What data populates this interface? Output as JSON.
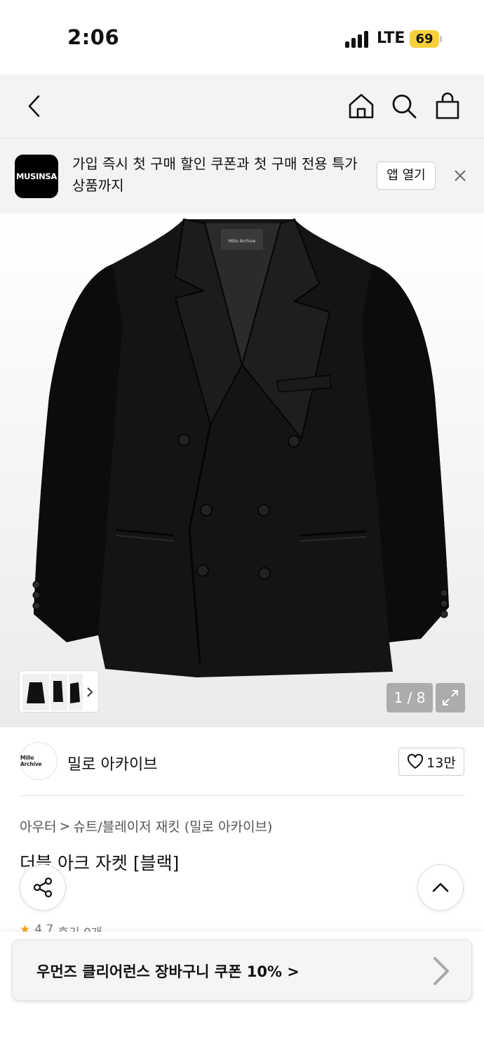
{
  "status": {
    "time": "2:06",
    "network": "LTE",
    "battery": "69"
  },
  "banner": {
    "logo_text": "MUSINSA",
    "message": "가입 즉시 첫 구매 할인 쿠폰과 첫 구매 전용 특가 상품까지",
    "open_app_label": "앱 열기"
  },
  "gallery": {
    "jacket_label": "Millo Archive",
    "page_indicator": "1 / 8"
  },
  "brand": {
    "logo_text": "Millo Archive",
    "name": "밀로 아카이브",
    "likes": "13만"
  },
  "breadcrumb": {
    "level1": "아우터",
    "separator": ">",
    "level2": "슈트/블레이저 재킷 (밀로 아카이브)"
  },
  "product": {
    "title": "더블 아크 자켓 [블랙]",
    "rating": "4.7",
    "reviews": "후기 0개"
  },
  "coupon": {
    "text": "우먼즈 클리어런스 장바구니 쿠폰 10% >"
  },
  "colors": {
    "accent": "#f6d03a",
    "star": "#f5a623",
    "header_bg": "#f3f3f3"
  }
}
